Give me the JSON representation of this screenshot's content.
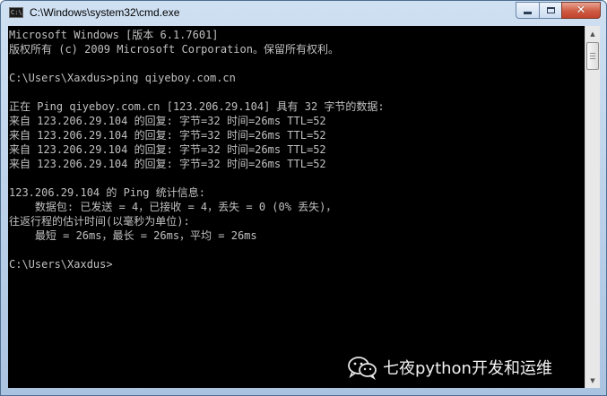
{
  "window": {
    "title": "C:\\Windows\\system32\\cmd.exe",
    "app_icon_text": "C:\\",
    "controls": {
      "minimize": "minimize-icon",
      "maximize": "maximize-icon",
      "close": "close-icon",
      "close_glyph": "✕"
    }
  },
  "console": {
    "lines": [
      "Microsoft Windows [版本 6.1.7601]",
      "版权所有 (c) 2009 Microsoft Corporation。保留所有权利。",
      "",
      "C:\\Users\\Xaxdus>ping qiyeboy.com.cn",
      "",
      "正在 Ping qiyeboy.com.cn [123.206.29.104] 具有 32 字节的数据:",
      "来自 123.206.29.104 的回复: 字节=32 时间=26ms TTL=52",
      "来自 123.206.29.104 的回复: 字节=32 时间=26ms TTL=52",
      "来自 123.206.29.104 的回复: 字节=32 时间=26ms TTL=52",
      "来自 123.206.29.104 的回复: 字节=32 时间=26ms TTL=52",
      "",
      "123.206.29.104 的 Ping 统计信息:",
      "    数据包: 已发送 = 4，已接收 = 4，丢失 = 0 (0% 丢失)，",
      "往返行程的估计时间(以毫秒为单位):",
      "    最短 = 26ms，最长 = 26ms，平均 = 26ms",
      "",
      "C:\\Users\\Xaxdus>"
    ],
    "foreground": "#c0c0c0",
    "background": "#000000"
  },
  "watermark": {
    "text": "七夜python开发和运维",
    "icon": "wechat-icon"
  },
  "scrollbar": {
    "up_glyph": "▲",
    "down_glyph": "▼"
  }
}
